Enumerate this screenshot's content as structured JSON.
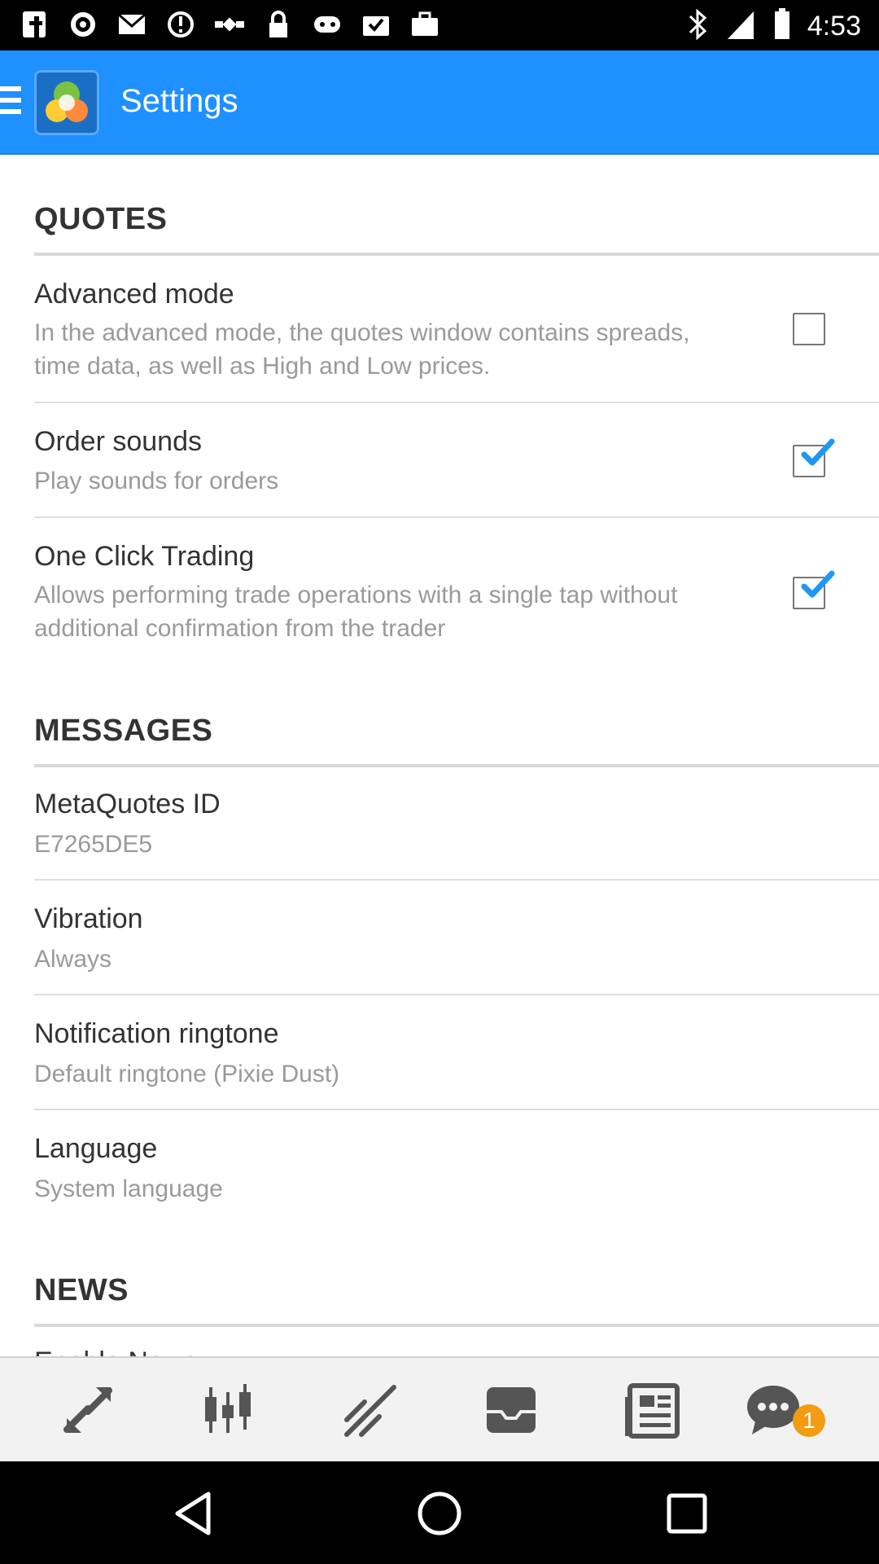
{
  "status_bar": {
    "time": "4:53",
    "left_icons": [
      "facebook-icon",
      "settings-icon",
      "gmail-icon",
      "blocked-icon",
      "satellite-icon",
      "lock-icon",
      "gamepad-icon",
      "inbox-check-icon",
      "briefcase-icon"
    ],
    "right_icons": [
      "bluetooth-icon",
      "signal-icon",
      "battery-icon"
    ]
  },
  "app_bar": {
    "title": "Settings",
    "colors": {
      "background": "#1e90ff"
    }
  },
  "sections": {
    "quotes": {
      "header": "QUOTES",
      "items": [
        {
          "title": "Advanced mode",
          "subtitle": "In the advanced mode, the quotes window contains spreads, time data, as well as High and Low prices.",
          "checked": false
        },
        {
          "title": "Order sounds",
          "subtitle": "Play sounds for orders",
          "checked": true
        },
        {
          "title": "One Click Trading",
          "subtitle": "Allows performing trade operations with a single tap without additional confirmation from the trader",
          "checked": true
        }
      ]
    },
    "messages": {
      "header": "MESSAGES",
      "items": [
        {
          "title": "MetaQuotes ID",
          "subtitle": "E7265DE5"
        },
        {
          "title": "Vibration",
          "subtitle": "Always"
        },
        {
          "title": "Notification ringtone",
          "subtitle": "Default ringtone (Pixie Dust)"
        },
        {
          "title": "Language",
          "subtitle": "System language"
        }
      ]
    },
    "news": {
      "header": "NEWS",
      "items": [
        {
          "title": "Enable News"
        }
      ]
    }
  },
  "toolbar": {
    "buttons": [
      "quotes-arrows-icon",
      "chart-candles-icon",
      "trade-chart-icon",
      "inbox-tray-icon",
      "news-icon",
      "chat-icon"
    ],
    "chat_badge": "1",
    "colors": {
      "badge": "#f39c12"
    }
  },
  "nav_bar": {
    "buttons": [
      "back-icon",
      "home-icon",
      "recents-icon"
    ]
  }
}
